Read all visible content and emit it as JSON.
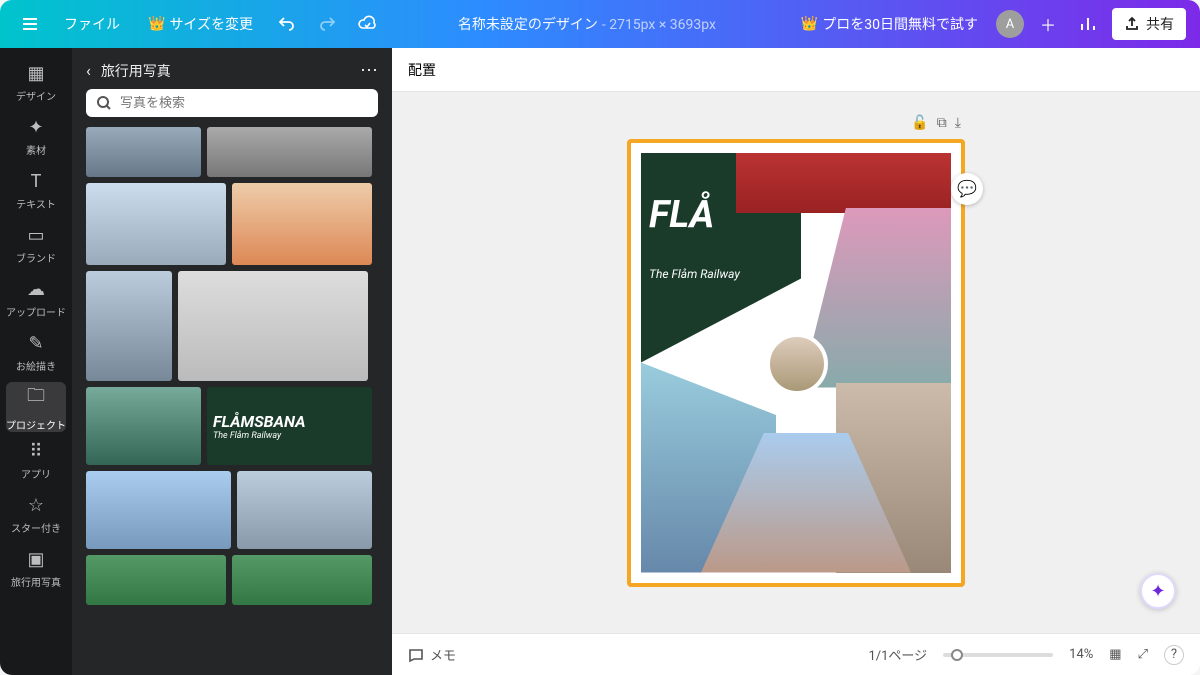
{
  "topbar": {
    "file_label": "ファイル",
    "resize_label": "サイズを変更",
    "doc_title": "名称未設定のデザイン",
    "dimensions": "- 2715px × 3693px",
    "trial_label": "プロを30日間無料で試す",
    "avatar_letter": "A",
    "share_label": "共有"
  },
  "rail": {
    "items": [
      {
        "label": "デザイン",
        "icon": "▦"
      },
      {
        "label": "素材",
        "icon": "✦"
      },
      {
        "label": "テキスト",
        "icon": "T"
      },
      {
        "label": "ブランド",
        "icon": "▭"
      },
      {
        "label": "アップロード",
        "icon": "☁"
      },
      {
        "label": "お絵描き",
        "icon": "✎"
      },
      {
        "label": "プロジェクト",
        "icon": "🗀"
      },
      {
        "label": "アプリ",
        "icon": "⠿"
      },
      {
        "label": "スター付き",
        "icon": "☆"
      },
      {
        "label": "旅行用写真",
        "icon": "▣"
      }
    ],
    "active_index": 6
  },
  "side": {
    "panel_title": "旅行用写真",
    "search_placeholder": "写真を検索"
  },
  "toolbar": {
    "position_label": "配置"
  },
  "page_tools": {
    "lock": "🔓",
    "duplicate": "⧉",
    "add": "⤓"
  },
  "bottom": {
    "notes_label": "メモ",
    "page_indicator": "1/1ページ",
    "zoom_label": "14%"
  },
  "collage": {
    "flam_title": "FLÅ",
    "flam_sub": "The Flåm Railway",
    "flamsbana": "FLÅMSBANA",
    "flamsbana_sub": "The Flåm Railway"
  }
}
